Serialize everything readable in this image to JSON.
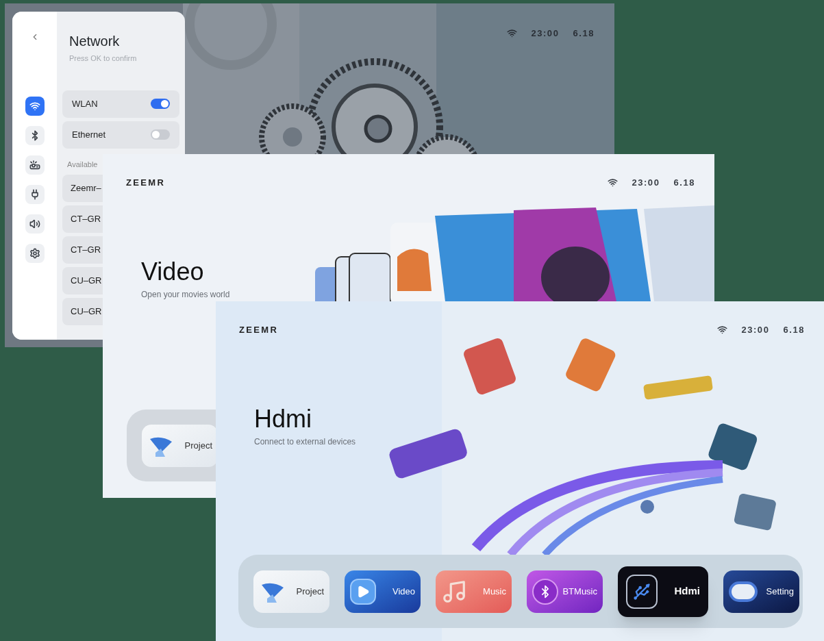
{
  "screens": [
    {
      "kind": "settings",
      "status": {
        "time": "23:00",
        "date": "6.18"
      },
      "panel": {
        "title": "Network",
        "subtitle": "Press OK to confirm",
        "rail": [
          {
            "kind": "wifi",
            "selected": true
          },
          {
            "kind": "bluetooth",
            "selected": false
          },
          {
            "kind": "projector",
            "selected": false
          },
          {
            "kind": "plug",
            "selected": false
          },
          {
            "kind": "sound",
            "selected": false
          },
          {
            "kind": "settings",
            "selected": false
          }
        ],
        "toggles": [
          {
            "label": "WLAN",
            "on": true
          },
          {
            "label": "Ethernet",
            "on": false
          }
        ],
        "section_label": "Available",
        "networks": [
          {
            "name": "Zeemr–"
          },
          {
            "name": "CT–GR"
          },
          {
            "name": "CT–GR"
          },
          {
            "name": "CU–GR"
          },
          {
            "name": "CU–GR"
          }
        ]
      }
    },
    {
      "kind": "home",
      "logo": "ZEEMR",
      "status": {
        "time": "23:00",
        "date": "6.18"
      },
      "title": "Video",
      "subtitle": "Open your movies world",
      "dock": [
        {
          "kind": "project",
          "label": "Project",
          "selected": false
        }
      ]
    },
    {
      "kind": "home",
      "logo": "ZEEMR",
      "status": {
        "time": "23:00",
        "date": "6.18"
      },
      "title": "Hdmi",
      "subtitle": "Connect to external devices",
      "dock": [
        {
          "kind": "project",
          "label": "Project",
          "selected": false
        },
        {
          "kind": "video",
          "label": "Video",
          "selected": false
        },
        {
          "kind": "music",
          "label": "Music",
          "selected": false
        },
        {
          "kind": "bluetooth",
          "label": "BTMusic",
          "selected": false
        },
        {
          "kind": "hdmi",
          "label": "Hdmi",
          "selected": true
        },
        {
          "kind": "settings",
          "label": "Setting",
          "selected": false
        }
      ]
    }
  ]
}
